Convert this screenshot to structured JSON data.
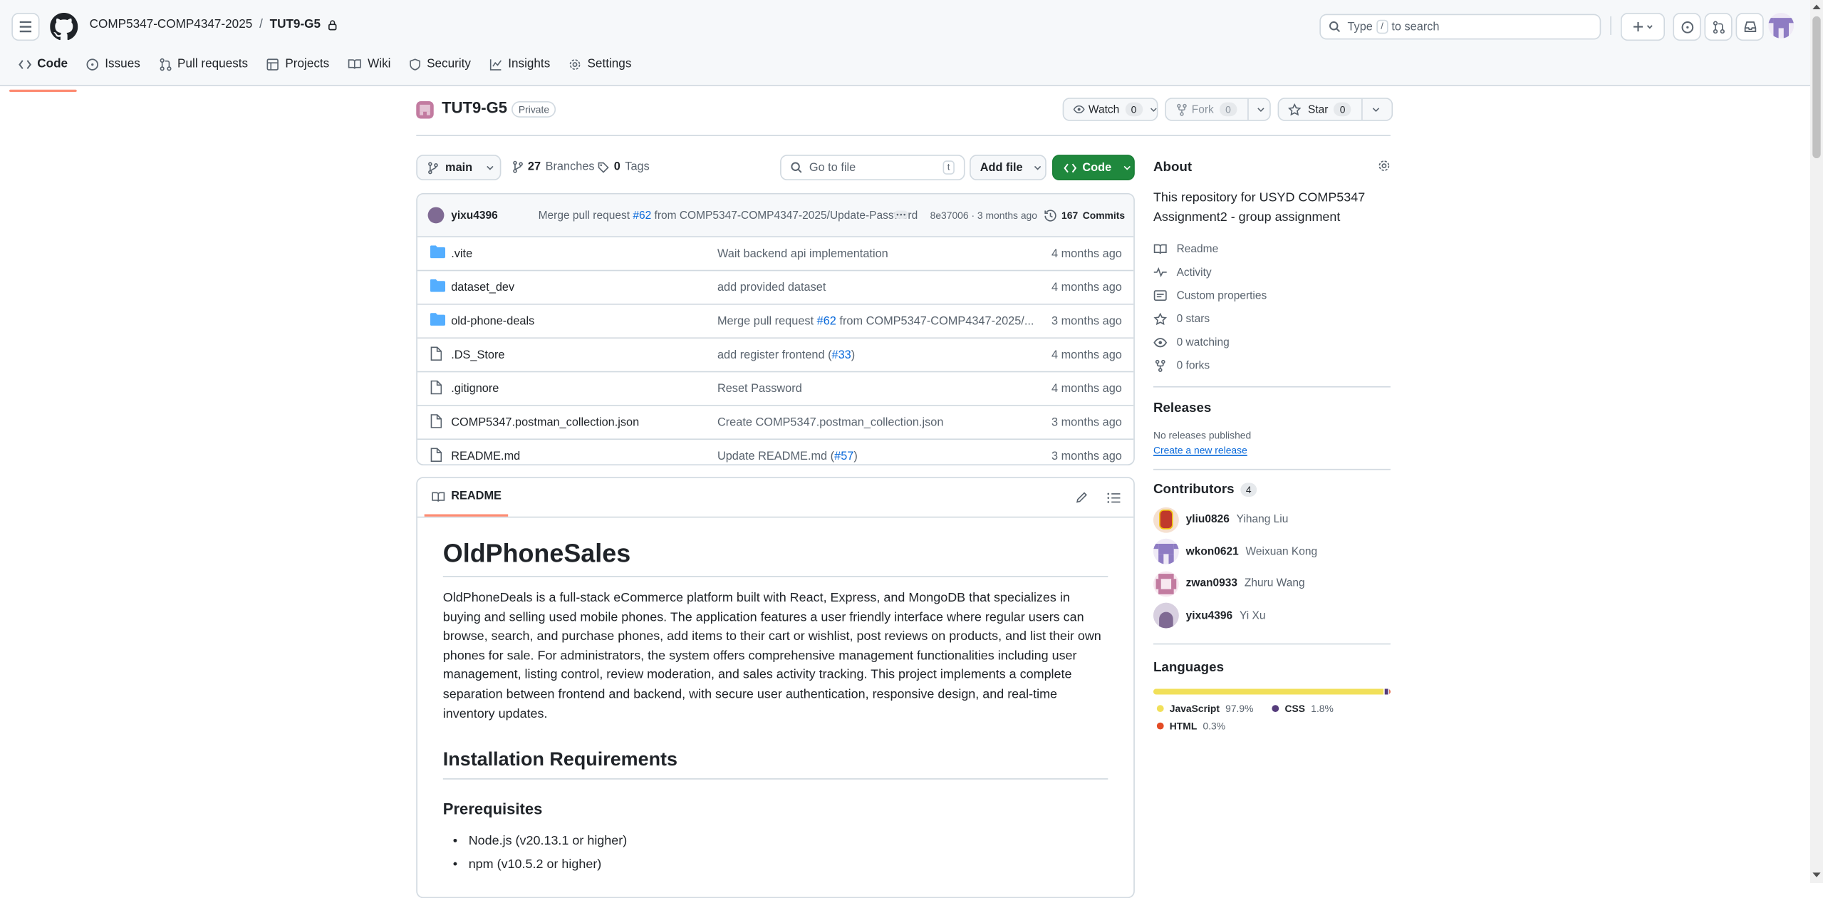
{
  "header": {
    "owner": "COMP5347-COMP4347-2025",
    "repo": "TUT9-G5",
    "search_text_prefix": "Type",
    "search_key": "/",
    "search_text_suffix": "to search"
  },
  "repo_nav": [
    {
      "label": "Code",
      "icon": "code-icon"
    },
    {
      "label": "Issues",
      "icon": "issue-icon"
    },
    {
      "label": "Pull requests",
      "icon": "pull-request-icon"
    },
    {
      "label": "Projects",
      "icon": "table-icon"
    },
    {
      "label": "Wiki",
      "icon": "book-icon"
    },
    {
      "label": "Security",
      "icon": "shield-icon"
    },
    {
      "label": "Insights",
      "icon": "graph-icon"
    },
    {
      "label": "Settings",
      "icon": "gear-icon"
    }
  ],
  "repo": {
    "name": "TUT9-G5",
    "visibility": "Private",
    "watch_label": "Watch",
    "watch_count": "0",
    "fork_label": "Fork",
    "fork_count": "0",
    "star_label": "Star",
    "star_count": "0"
  },
  "toolbar": {
    "branch": "main",
    "branches_count": "27",
    "branches_label": "Branches",
    "tags_count": "0",
    "tags_label": "Tags",
    "goto_placeholder": "Go to file",
    "goto_key": "t",
    "add_file": "Add file",
    "code": "Code"
  },
  "last_commit": {
    "author": "yixu4396",
    "msg_prefix": "Merge pull request",
    "pr": "#62",
    "msg_suffix": "from COMP5347-COMP4347-2025/Update-Password",
    "sha_time": "8e37006 · 3 months ago",
    "commits_count": "167",
    "commits_label": "Commits"
  },
  "files": [
    {
      "name": ".vite",
      "type": "folder",
      "msg": "Wait backend api implementation",
      "link": "",
      "tail": "",
      "date": "4 months ago"
    },
    {
      "name": "dataset_dev",
      "type": "folder",
      "msg": "add provided dataset",
      "link": "",
      "tail": "",
      "date": "4 months ago"
    },
    {
      "name": "old-phone-deals",
      "type": "folder",
      "msg": "Merge pull request ",
      "link": "#62",
      "tail": " from COMP5347-COMP4347-2025/...",
      "date": "3 months ago"
    },
    {
      "name": ".DS_Store",
      "type": "file",
      "msg": "add register frontend (",
      "link": "#33",
      "tail": ")",
      "date": "4 months ago"
    },
    {
      "name": ".gitignore",
      "type": "file",
      "msg": "Reset Password",
      "link": "",
      "tail": "",
      "date": "4 months ago"
    },
    {
      "name": "COMP5347.postman_collection.json",
      "type": "file",
      "msg": "Create COMP5347.postman_collection.json",
      "link": "",
      "tail": "",
      "date": "3 months ago"
    },
    {
      "name": "README.md",
      "type": "file",
      "msg": "Update README.md (",
      "link": "#57",
      "tail": ")",
      "date": "3 months ago"
    }
  ],
  "readme": {
    "tab": "README",
    "h1": "OldPhoneSales",
    "p1": "OldPhoneDeals is a full-stack eCommerce platform built with React, Express, and MongoDB that specializes in buying and selling used mobile phones. The application features a user friendly interface where regular users can browse, search, and purchase phones, add items to their cart or wishlist, post reviews on products, and list their own phones for sale. For administrators, the system offers comprehensive management functionalities including user management, listing control, review moderation, and sales activity tracking. This project implements a complete separation between frontend and backend, with secure user authentication, responsive design, and real-time inventory updates.",
    "h2": "Installation Requirements",
    "h3": "Prerequisites",
    "items": [
      "Node.js (v20.13.1 or higher)",
      "npm (v10.5.2 or higher)"
    ]
  },
  "about": {
    "title": "About",
    "description": "This repository for USYD COMP5347 Assignment2 - group assignment",
    "links": [
      {
        "label": "Readme",
        "icon": "book-icon"
      },
      {
        "label": "Activity",
        "icon": "pulse-icon"
      },
      {
        "label": "Custom properties",
        "icon": "note-icon"
      },
      {
        "label": "0 stars",
        "icon": "star-icon"
      },
      {
        "label": "0 watching",
        "icon": "eye-icon"
      },
      {
        "label": "0 forks",
        "icon": "fork-icon"
      }
    ]
  },
  "releases": {
    "title": "Releases",
    "none": "No releases published",
    "create": "Create a new release"
  },
  "contributors": {
    "title": "Contributors",
    "count": "4",
    "list": [
      {
        "login": "yliu0826",
        "name": "Yihang Liu",
        "color": "#c0392b"
      },
      {
        "login": "wkon0621",
        "name": "Weixuan Kong",
        "color": "#8e7cc3"
      },
      {
        "login": "zwan0933",
        "name": "Zhuru Wang",
        "color": "#c27ba0"
      },
      {
        "login": "yixu4396",
        "name": "Yi Xu",
        "color": "#7f6a93"
      }
    ]
  },
  "languages": {
    "title": "Languages",
    "list": [
      {
        "name": "JavaScript",
        "pct": "97.9%",
        "color": "#f1e05a",
        "value": 97.9
      },
      {
        "name": "CSS",
        "pct": "1.8%",
        "color": "#563d7c",
        "value": 1.8
      },
      {
        "name": "HTML",
        "pct": "0.3%",
        "color": "#e34c26",
        "value": 0.3
      }
    ]
  },
  "colors": {
    "accent": "#0969da",
    "green": "#1f883d",
    "tab_underline": "#fd8c73"
  }
}
